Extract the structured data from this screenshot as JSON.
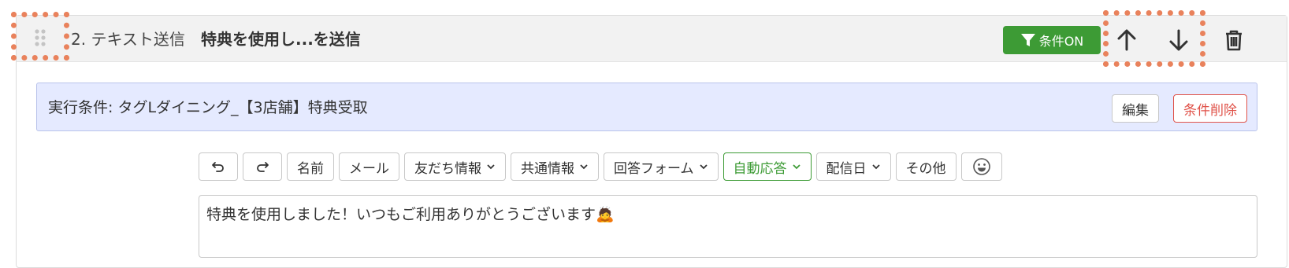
{
  "step": {
    "number_label": "2. テキスト送信",
    "name": "特典を使用し...を送信",
    "condition_badge": "条件ON"
  },
  "condition": {
    "text": "実行条件: タグLダイニング_【3店舗】特典受取",
    "edit_label": "編集",
    "delete_label": "条件削除"
  },
  "toolbar": {
    "name": "名前",
    "mail": "メール",
    "friend_info": "友だち情報",
    "common_info": "共通情報",
    "answer_form": "回答フォーム",
    "auto_reply": "自動応答",
    "delivery_date": "配信日",
    "other": "その他"
  },
  "message": {
    "text": "特典を使用しました！いつもご利用ありがとうございます🙇"
  },
  "colors": {
    "accent_green": "#3d9b35",
    "danger_red": "#e0534a",
    "condition_bg": "#e5eaff",
    "highlight_dotted": "#e9825c"
  },
  "icons": [
    "drag-handle-icon",
    "filter-icon",
    "arrow-up-icon",
    "arrow-down-icon",
    "trash-icon",
    "undo-icon",
    "redo-icon",
    "chevron-down-icon",
    "smiley-icon"
  ]
}
